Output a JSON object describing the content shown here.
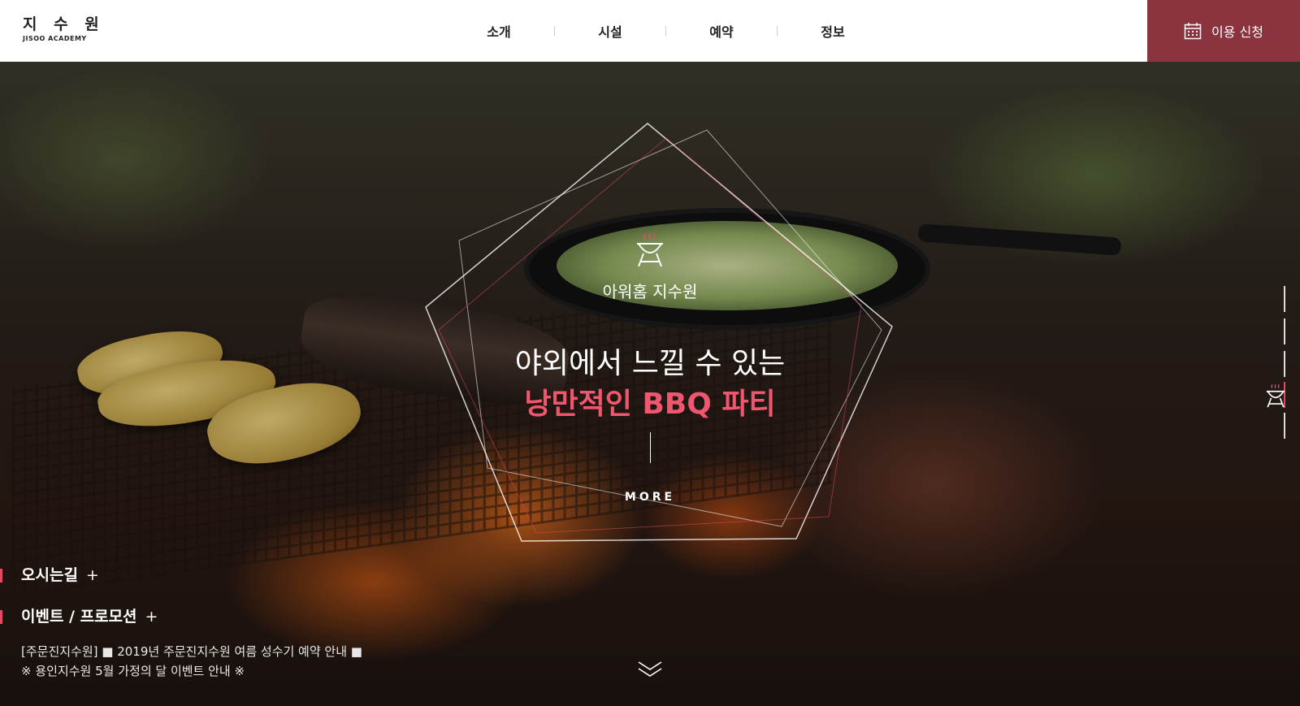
{
  "logo": {
    "korean": "지 수 원",
    "english": "JISOO ACADEMY"
  },
  "nav": {
    "items": [
      {
        "label": "소개"
      },
      {
        "label": "시설"
      },
      {
        "label": "예약"
      },
      {
        "label": "정보"
      }
    ]
  },
  "apply": {
    "label": "이용 신청",
    "icon": "calendar-icon"
  },
  "hero": {
    "subtitle": "아워홈 지수원",
    "headline_line1": "야외에서 느낄 수 있는",
    "headline_line2": "낭만적인 BBQ 파티",
    "more_label": "MORE",
    "icon": "bbq-grill-icon"
  },
  "side_indicator": {
    "count": 5,
    "active_index": 3
  },
  "quick_links": [
    {
      "label": "오시는길",
      "plus": "+"
    },
    {
      "label": "이벤트 / 프로모션",
      "plus": "+"
    }
  ],
  "news": [
    "[주문진지수원] ■ 2019년 주문진지수원 여름 성수기 예약 안내 ■",
    "※ 용인지수원 5월 가정의 달 이벤트 안내 ※"
  ],
  "colors": {
    "accent": "#e54a63",
    "apply_bg": "#8b3440",
    "headline_pink": "#f0566d"
  }
}
